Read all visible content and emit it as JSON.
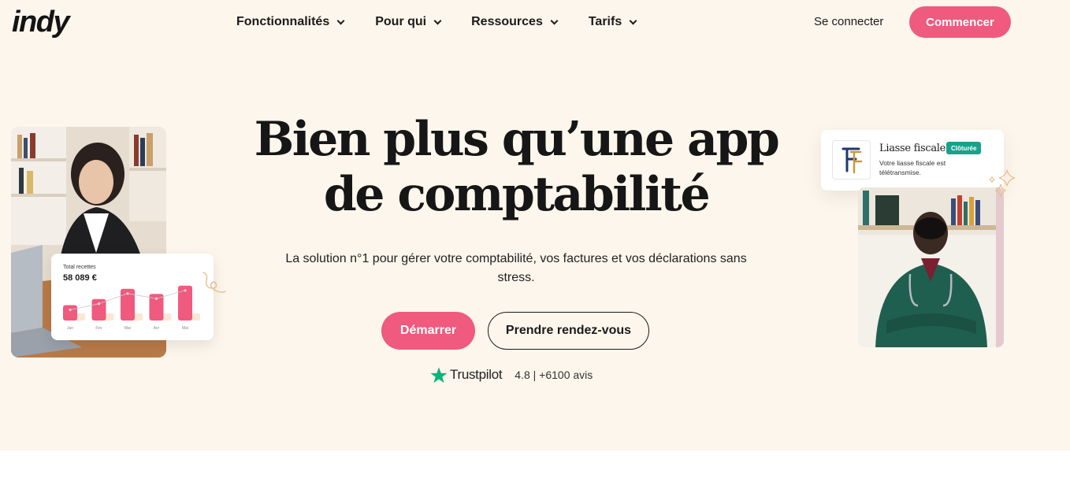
{
  "header": {
    "logo": "indy",
    "nav": [
      {
        "label": "Fonctionnalités"
      },
      {
        "label": "Pour qui"
      },
      {
        "label": "Ressources"
      },
      {
        "label": "Tarifs"
      }
    ],
    "login_label": "Se connecter",
    "cta_label": "Commencer"
  },
  "hero": {
    "title_line1": "Bien plus qu’une app",
    "title_line2": "de comptabilité",
    "subtitle": "La solution n°1 pour gérer votre comptabilité, vos factures et vos déclarations sans stress.",
    "primary_button": "Démarrer",
    "secondary_button": "Prendre rendez-vous",
    "trustpilot": {
      "brand": "Trustpilot",
      "rating_text": "4.8 | +6100 avis"
    }
  },
  "revenue_card": {
    "label": "Total recettes",
    "value": "58 089 €",
    "months": [
      "Jan",
      "Fev",
      "Mar",
      "Avr",
      "Mai"
    ],
    "values": [
      0.3,
      0.42,
      0.62,
      0.52,
      0.68
    ]
  },
  "liasse_card": {
    "title": "Liasse fiscale",
    "badge": "Clôturée",
    "description": "Votre liasse fiscale est télétransmise."
  },
  "colors": {
    "accent": "#ef5a7e",
    "hero_bg": "#fdf6ec",
    "badge": "#17a38b",
    "trustpilot": "#00b67a"
  }
}
